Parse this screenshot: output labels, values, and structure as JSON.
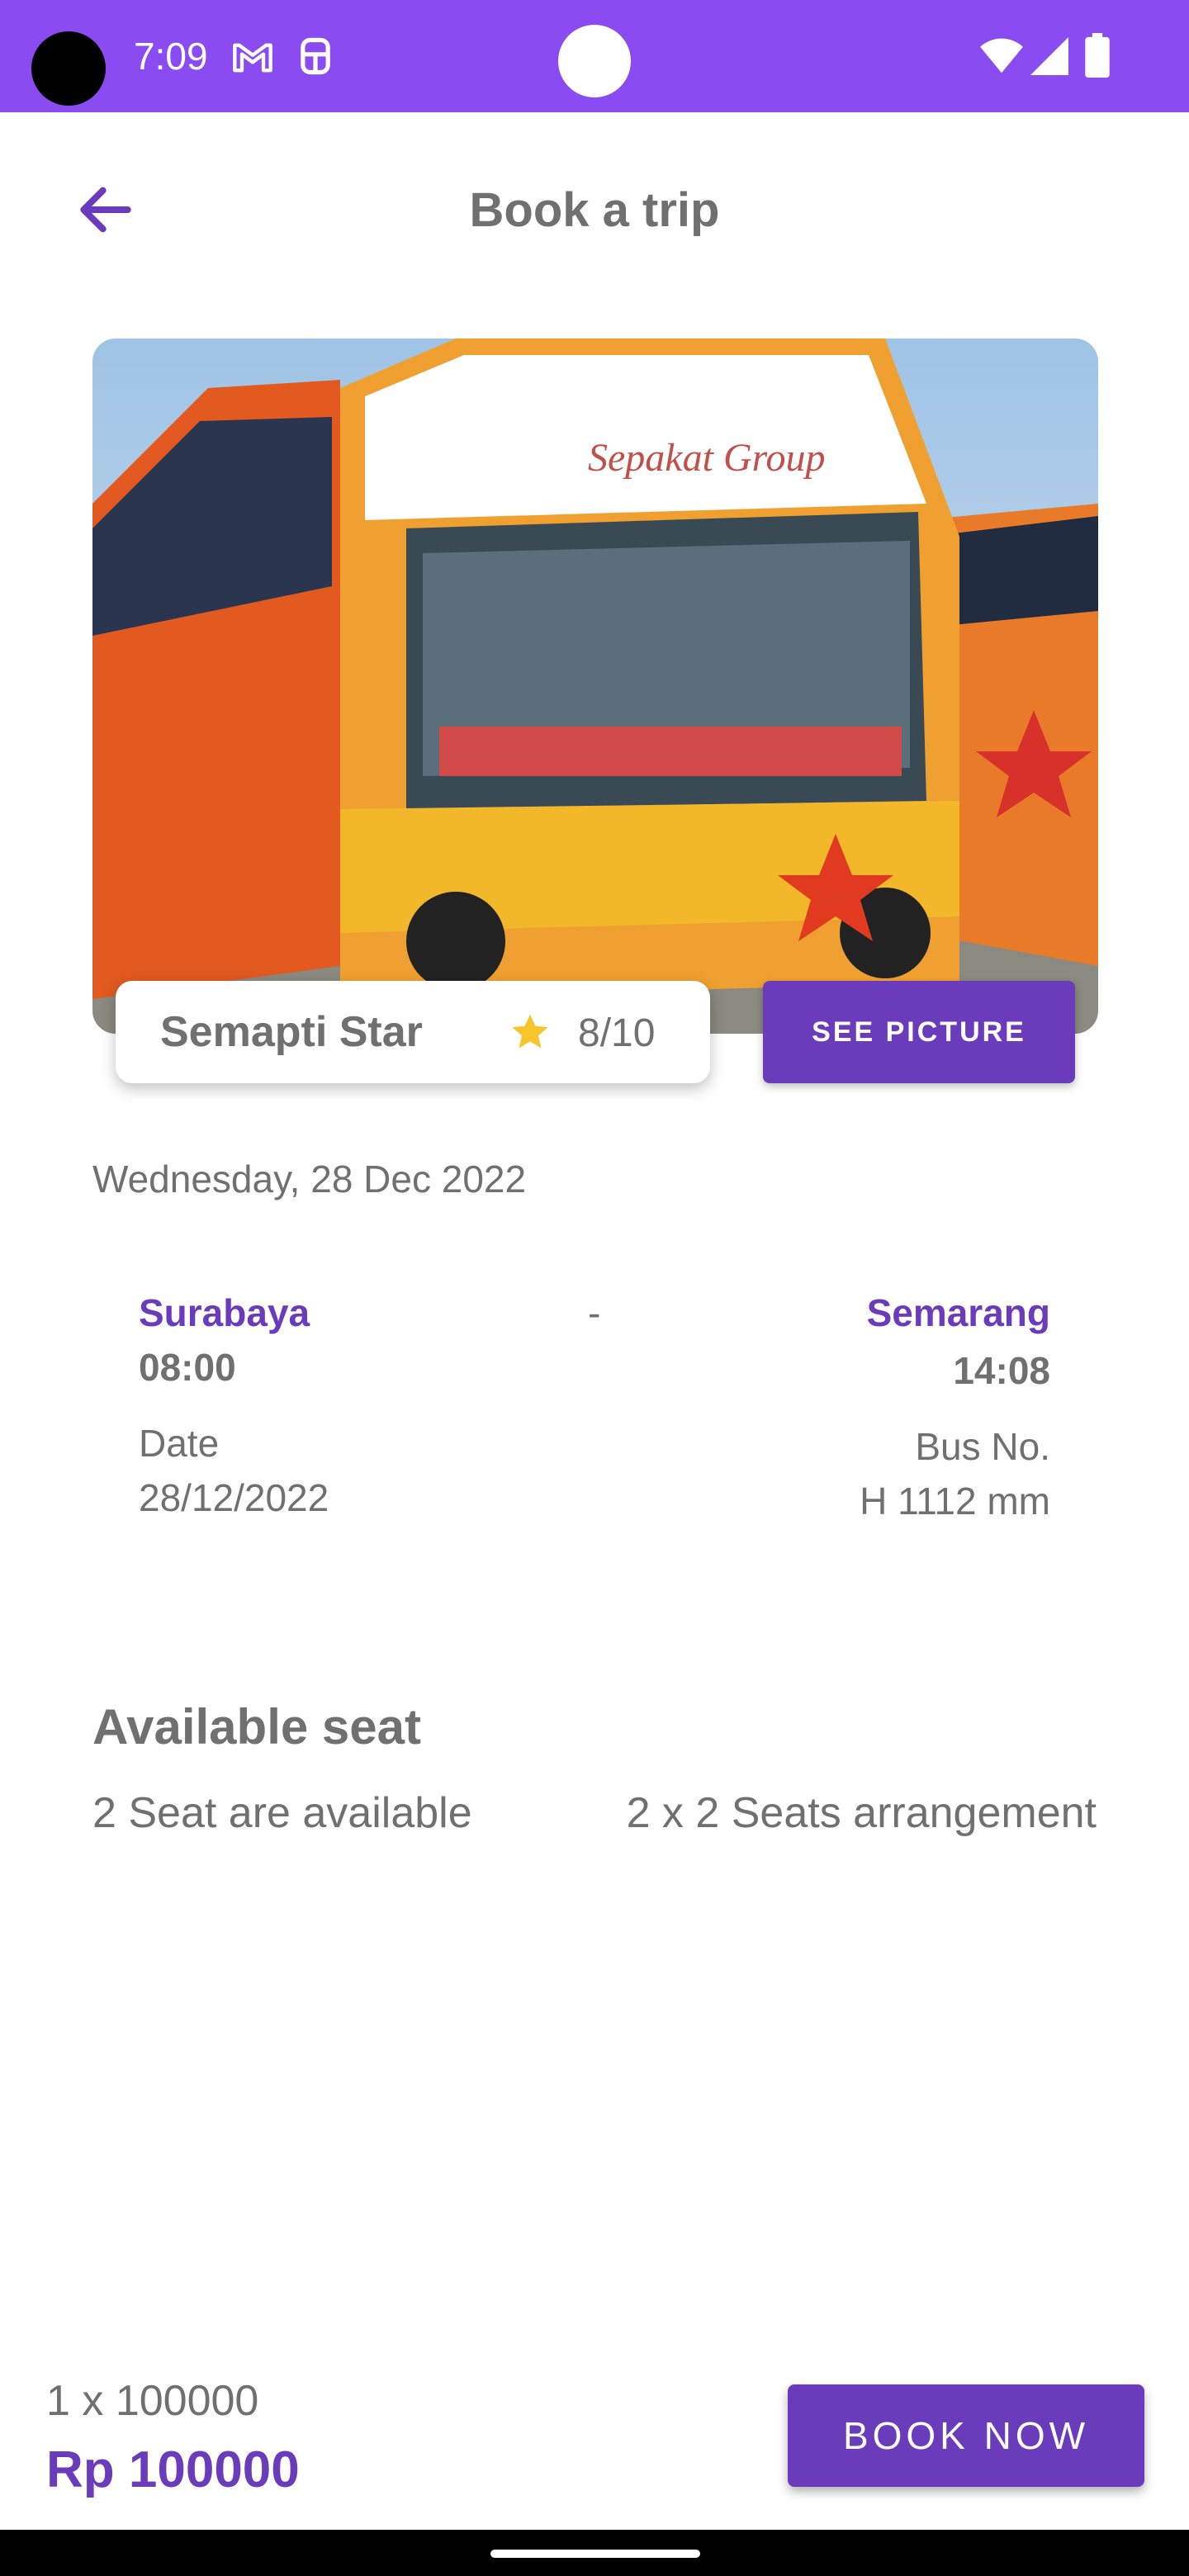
{
  "status_bar": {
    "time": "7:09",
    "icons": [
      "gmail-icon",
      "android-icon",
      "wifi-icon",
      "signal-icon",
      "battery-icon"
    ],
    "background": "#8a4cf0"
  },
  "app_bar": {
    "title": "Book a trip",
    "back_icon": "arrow-back-icon"
  },
  "bus": {
    "image": "bus-photo",
    "name": "Semapti Star",
    "rating": "8/10",
    "see_picture_label": "SEE PICTURE"
  },
  "trip": {
    "day_date": "Wednesday, 28 Dec 2022",
    "origin": "Surabaya",
    "depart_time": "08:00",
    "separator": "-",
    "destination": "Semarang",
    "arrive_time": "14:08",
    "date_label": "Date",
    "date_value": "28/12/2022",
    "bus_no_label": "Bus No.",
    "bus_no_value": "H 1112 mm"
  },
  "seats": {
    "heading": "Available seat",
    "available": "2 Seat are available",
    "arrangement": "2 x 2 Seats arrangement"
  },
  "footer": {
    "quantity": "1 x 100000",
    "total": "Rp 100000",
    "book_label": "BOOK NOW"
  },
  "colors": {
    "accent": "#6a3cbc",
    "text_grey": "#707070",
    "star": "#f8c62c"
  }
}
